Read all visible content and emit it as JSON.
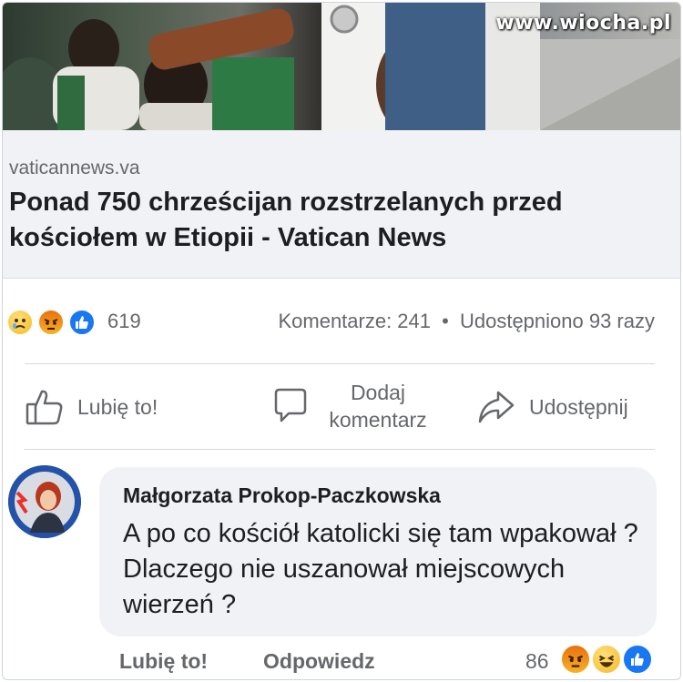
{
  "watermark": "www.wiocha.pl",
  "link_preview": {
    "domain": "vaticannews.va",
    "headline": "Ponad 750 chrześcijan rozstrzelanych przed kościołem w Etiopii - Vatican News"
  },
  "reactions": {
    "icons": [
      "sad-emoji",
      "angry-emoji",
      "like-emoji"
    ],
    "count": "619",
    "comments": "Komentarze: 241",
    "separator": "•",
    "shares": "Udostępniono 93 razy"
  },
  "actions": {
    "like": "Lubię to!",
    "comment_line1": "Dodaj",
    "comment_line2": "komentarz",
    "share": "Udostępnij"
  },
  "comment": {
    "author": "Małgorzata Prokop-Paczkowska",
    "text": "A po co kościół katolicki się tam wpakował ? Dlaczego nie uszanował miejscowych wierzeń ?",
    "like": "Lubię to!",
    "reply": "Odpowiedz",
    "reaction_count": "86",
    "reaction_icons": [
      "angry-emoji",
      "laugh-emoji",
      "like-emoji"
    ]
  },
  "colors": {
    "facebook_blue": "#1877f2",
    "gray_text": "#65676b",
    "bubble_bg": "#f0f2f5"
  }
}
